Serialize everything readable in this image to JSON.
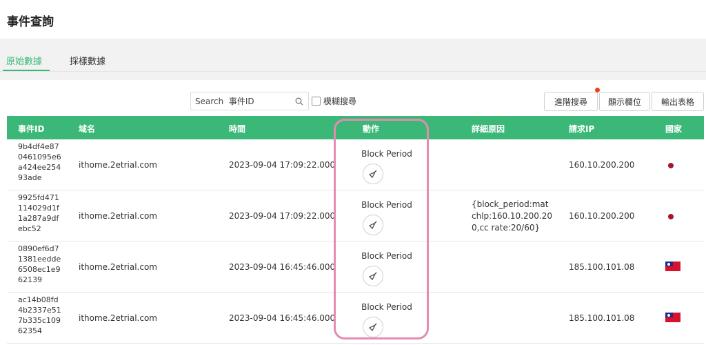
{
  "page": {
    "title": "事件查詢"
  },
  "tabs": [
    {
      "label": "原始數據",
      "active": true
    },
    {
      "label": "採樣數據",
      "active": false
    }
  ],
  "toolbar": {
    "search_placeholder": "Search  事件ID",
    "fuzzy_label": "模糊搜尋",
    "advanced_label": "進階搜尋",
    "columns_label": "顯示欄位",
    "export_label": "輸出表格"
  },
  "table": {
    "headers": {
      "event_id": "事件ID",
      "domain": "域名",
      "time": "時間",
      "action": "動作",
      "reason": "詳細原因",
      "ip": "請求IP",
      "country": "國家"
    },
    "rows": [
      {
        "event_id": "9b4df4e870461095e6a424ee25493ade",
        "domain": "ithome.2etrial.com",
        "time": "2023-09-04 17:09:22.000",
        "action": "Block Period",
        "reason": "",
        "ip": "160.10.200.200",
        "country_icon": "red-dot"
      },
      {
        "event_id": "9925fd471114029d1f1a287a9dfebc52",
        "domain": "ithome.2etrial.com",
        "time": "2023-09-04 17:09:22.000",
        "action": "Block Period",
        "reason": "{block_period:matchlp:160.10.200.200,cc rate:20/60}",
        "ip": "160.10.200.200",
        "country_icon": "red-dot"
      },
      {
        "event_id": "0890ef6d71381eedde6508ec1e962139",
        "domain": "ithome.2etrial.com",
        "time": "2023-09-04 16:45:46.000",
        "action": "Block Period",
        "reason": "",
        "ip": "185.100.101.08",
        "country_icon": "taiwan-flag"
      },
      {
        "event_id": "ac14b08fd4b2337e517b335c10962354",
        "domain": "ithome.2etrial.com",
        "time": "2023-09-04 16:45:46.000",
        "action": "Block Period",
        "reason": "",
        "ip": "185.100.101.08",
        "country_icon": "taiwan-flag"
      }
    ]
  },
  "colors": {
    "accent": "#3bb877",
    "highlight": "#e48bb2",
    "notification": "#e8431e"
  }
}
